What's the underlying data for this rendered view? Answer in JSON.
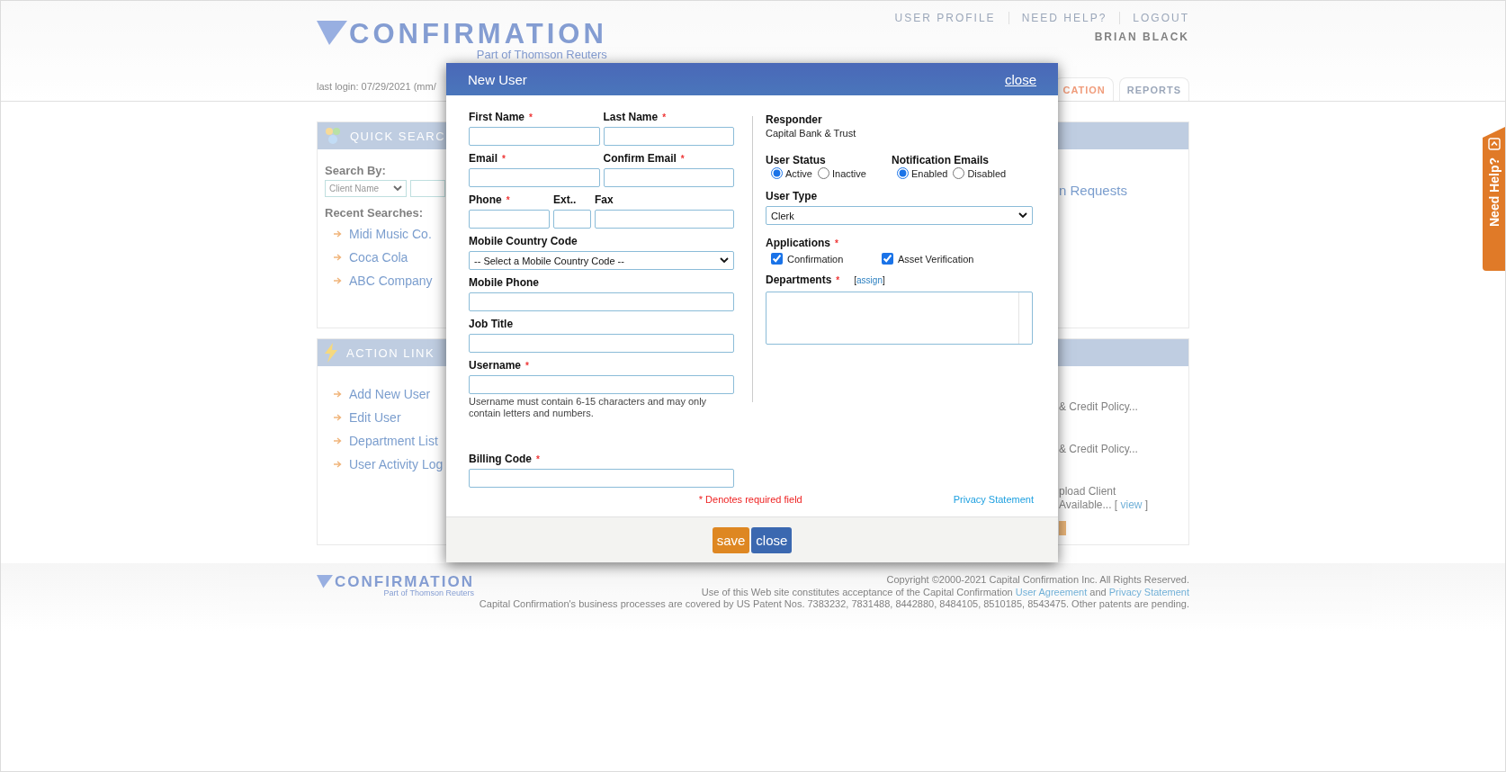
{
  "header": {
    "logo": {
      "wordmark": "CONFIRMATION",
      "tagline": "Part of Thomson Reuters"
    },
    "top_links": [
      "USER PROFILE",
      "NEED HELP?",
      "LOGOUT"
    ],
    "user_name": "BRIAN BLACK",
    "last_login": "last login: 07/29/2021 (mm/",
    "tabs": [
      {
        "label": "CATION",
        "selected": true
      },
      {
        "label": "REPORTS",
        "selected": false
      }
    ]
  },
  "panels": [
    {
      "title": "QUICK SEARC",
      "kind": "search",
      "search_by": "Search By:",
      "search_select": "Client Name",
      "recent_label": "Recent Searches:",
      "links": [
        "Midi Music Co.",
        "Coca Cola",
        "ABC Company"
      ],
      "right_items": [
        {
          "parts": [
            {
              "text": "n Requests",
              "kind": "link"
            }
          ]
        }
      ]
    },
    {
      "title": "ACTION LINK",
      "kind": "actions",
      "links": [
        "Add New User",
        "Edit User",
        "Department List",
        "User Activity Log"
      ],
      "right_items": [
        {
          "parts": [
            {
              "text": "& Credit Policy...",
              "kind": "text"
            }
          ]
        },
        {
          "parts": [
            {
              "text": "& Credit Policy...",
              "kind": "text"
            }
          ]
        },
        {
          "parts": [
            {
              "text": "pload Client",
              "kind": "text"
            }
          ]
        },
        {
          "parts": [
            {
              "text": "Available... [",
              "kind": "text"
            },
            {
              "text": "view",
              "kind": "link"
            },
            {
              "text": "]",
              "kind": "text"
            }
          ]
        }
      ]
    }
  ],
  "footer": {
    "logo": {
      "wordmark": "CONFIRMATION",
      "tagline": "Part of Thomson Reuters"
    },
    "lines": [
      {
        "parts": [
          {
            "text": "Copyright ©2000-2021 Capital Confirmation Inc. All Rights Reserved.",
            "kind": "text"
          }
        ]
      },
      {
        "parts": [
          {
            "text": "Use of this Web site constitutes acceptance of the Capital Confirmation",
            "kind": "text"
          },
          {
            "text": "User Agreement",
            "kind": "link"
          },
          {
            "text": "and",
            "kind": "text"
          },
          {
            "text": "Privacy Statement",
            "kind": "link"
          }
        ]
      },
      {
        "parts": [
          {
            "text": "Capital Confirmation's business processes are covered by US Patent Nos. 7383232, 7831488, 8442880, 8484105, 8510185, 8543475. Other patents are pending.",
            "kind": "text"
          }
        ]
      }
    ]
  },
  "need_help_tab": {
    "label": "Need Help?"
  },
  "modal": {
    "title": "New User",
    "close_link": "close",
    "left_rows": [
      [
        {
          "label": "First Name",
          "mark": "*",
          "kind": "input"
        },
        {
          "label": "Last Name",
          "mark": "*",
          "kind": "input"
        }
      ],
      [
        {
          "label": "Email",
          "mark": "*",
          "kind": "input"
        },
        {
          "label": "Confirm Email",
          "mark": "*",
          "kind": "input"
        }
      ],
      [
        {
          "label": "Phone",
          "mark": "*",
          "kind": "input"
        },
        {
          "label": "Ext..",
          "kind": "input"
        },
        {
          "label": "Fax",
          "kind": "input"
        }
      ],
      [
        {
          "label": "Mobile Country Code",
          "kind": "select",
          "value": "-- Select a Mobile Country Code --"
        }
      ],
      [
        {
          "label": "Mobile Phone",
          "kind": "input"
        }
      ],
      [
        {
          "label": "Job Title",
          "kind": "input"
        }
      ],
      [
        {
          "label": "Username",
          "mark": "*",
          "kind": "input",
          "hint": "Username must contain 6-15 characters and may only contain letters and numbers."
        }
      ],
      [
        {
          "label": "Billing Code",
          "mark": "*",
          "kind": "input"
        }
      ]
    ],
    "responder": {
      "label": "Responder",
      "value": "Capital Bank & Trust"
    },
    "radio_groups": [
      {
        "label": "User Status",
        "options": [
          {
            "label": "Active",
            "selected": true
          },
          {
            "label": "Inactive",
            "selected": false
          }
        ]
      },
      {
        "label": "Notification Emails",
        "options": [
          {
            "label": "Enabled",
            "selected": true
          },
          {
            "label": "Disabled",
            "selected": false
          }
        ]
      }
    ],
    "user_type": {
      "label": "User Type",
      "value": "Clerk"
    },
    "applications": {
      "label": "Applications",
      "mark": "*",
      "options": [
        {
          "label": "Confirmation",
          "checked": true
        },
        {
          "label": "Asset Verification",
          "checked": true
        }
      ]
    },
    "departments": {
      "label": "Departments",
      "mark": "*",
      "link_parts": [
        {
          "text": "[",
          "kind": "text"
        },
        {
          "text": "assign",
          "kind": "link"
        },
        {
          "text": "]",
          "kind": "text"
        }
      ]
    },
    "required_note": "* Denotes required field",
    "privacy_link": "Privacy Statement",
    "buttons": [
      {
        "label": "save",
        "kind": "primary"
      },
      {
        "label": "close",
        "kind": "secondary"
      }
    ]
  }
}
